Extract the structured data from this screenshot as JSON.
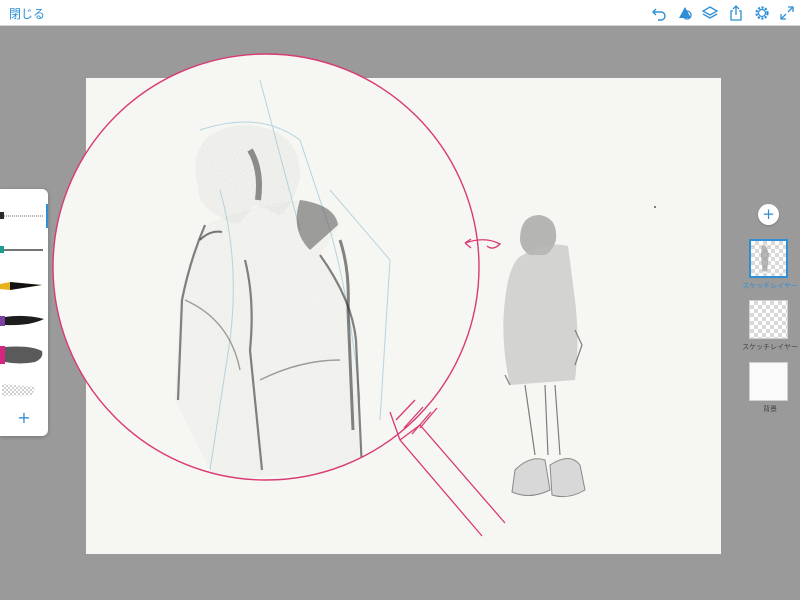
{
  "topbar": {
    "close_label": "閉じる",
    "tools": [
      "undo-icon",
      "shape-tool-icon",
      "layers-icon",
      "share-icon",
      "settings-icon",
      "fullscreen-icon"
    ]
  },
  "brushes": {
    "items": [
      {
        "name": "pencil-brush",
        "color": "#2b2b2b",
        "selected": true
      },
      {
        "name": "ink-pen-brush",
        "color": "#1a9e8f",
        "selected": false
      },
      {
        "name": "marker-brush",
        "color": "#e8b21a",
        "selected": false
      },
      {
        "name": "watercolor-brush",
        "color": "#7b3fa0",
        "selected": false
      },
      {
        "name": "paint-brush",
        "color": "#d6257f",
        "selected": false
      },
      {
        "name": "eraser-brush",
        "color": "#bbbbbb",
        "selected": false
      }
    ],
    "add_label": "+"
  },
  "layers": {
    "add_label": "+",
    "items": [
      {
        "label": "スケッチレイヤー",
        "selected": true
      },
      {
        "label": "スケッチレイヤー",
        "selected": false
      },
      {
        "label": "背景",
        "selected": false
      }
    ]
  },
  "colors": {
    "accent": "#2f8fd6",
    "annotation": "#d93a74",
    "background": "#9a9a9a",
    "canvas": "#f6f6f3"
  }
}
